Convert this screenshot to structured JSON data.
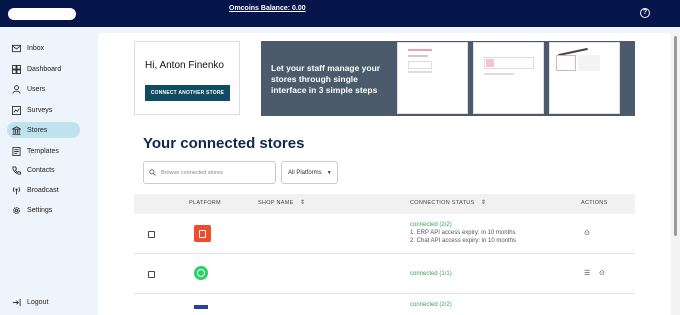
{
  "topbar": {
    "balance": "Omcoins Balance: 0.00",
    "help_icon": "?"
  },
  "sidebar": {
    "items": [
      {
        "label": "Inbox",
        "icon": "inbox-icon"
      },
      {
        "label": "Dashboard",
        "icon": "dashboard-icon"
      },
      {
        "label": "Users",
        "icon": "users-icon"
      },
      {
        "label": "Surveys",
        "icon": "surveys-icon"
      },
      {
        "label": "Stores",
        "icon": "stores-icon",
        "active": true
      },
      {
        "label": "Templates",
        "icon": "templates-icon"
      },
      {
        "label": "Contacts",
        "icon": "contacts-icon"
      },
      {
        "label": "Broadcast",
        "icon": "broadcast-icon"
      },
      {
        "label": "Settings",
        "icon": "settings-icon"
      }
    ],
    "logout": "Logout"
  },
  "greeting": {
    "text": "Hi, Anton Finenko",
    "button": "CONNECT ANOTHER STORE"
  },
  "banner": {
    "text": "Let your staff manage your stores through single interface in 3 simple steps"
  },
  "title": "Your connected stores",
  "search": {
    "placeholder": "Browse connected stores"
  },
  "platform_filter": {
    "value": "All Platforms"
  },
  "table": {
    "headers": {
      "platform": "PLATFORM",
      "shop_name": "SHOP NAME",
      "status": "CONNECTION STATUS",
      "actions": "ACTIONS"
    },
    "rows": [
      {
        "platform_icon": "shopee-icon",
        "status": "connected (2/2)",
        "details": [
          "1. ERP API access expiry: in 10 months",
          "2. Chat API access expiry: in 10 months"
        ]
      },
      {
        "platform_icon": "whatsapp-icon",
        "status": "connected (1/1)",
        "details": []
      },
      {
        "platform_icon": "platform-icon",
        "status": "connected (2/2)",
        "details": []
      }
    ]
  },
  "colors": {
    "topbar": "#06154a",
    "accent": "#0f4c62",
    "active_nav": "#bfe2ec",
    "connected": "#3aa455",
    "shopee": "#ee4d2d",
    "whatsapp": "#25d366"
  }
}
